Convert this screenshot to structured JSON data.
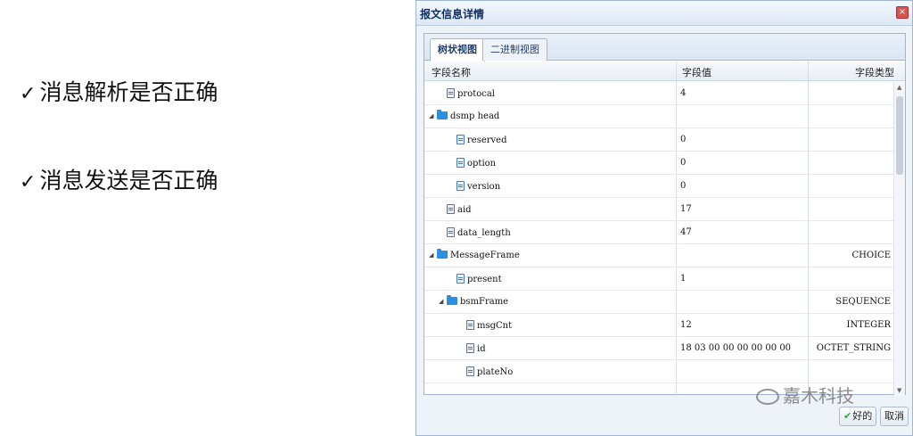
{
  "slide": {
    "bullets": [
      {
        "check": "✓",
        "text": "消息解析是否正确"
      },
      {
        "check": "✓",
        "text": "消息发送是否正确"
      }
    ]
  },
  "dialog": {
    "title": "报文信息详情",
    "close_label": "×",
    "tabs": [
      {
        "label": "树状视图",
        "active": true
      },
      {
        "label": "二进制视图",
        "active": false
      }
    ],
    "columns": [
      "字段名称",
      "字段值",
      "字段类型"
    ],
    "rows": [
      {
        "name": "protocal",
        "value": "4",
        "type": "",
        "icon": "leaf-icon",
        "level": 1,
        "toggle": ""
      },
      {
        "name": "dsmp head",
        "value": "",
        "type": "",
        "icon": "folder-icon",
        "level": 0,
        "toggle": "◢"
      },
      {
        "name": "reserved",
        "value": "0",
        "type": "",
        "icon": "leaf-icon",
        "level": 2,
        "toggle": ""
      },
      {
        "name": "option",
        "value": "0",
        "type": "",
        "icon": "leaf-icon",
        "level": 2,
        "toggle": ""
      },
      {
        "name": "version",
        "value": "0",
        "type": "",
        "icon": "leaf-icon",
        "level": 2,
        "toggle": ""
      },
      {
        "name": "aid",
        "value": "17",
        "type": "",
        "icon": "leaf-icon",
        "level": 1,
        "toggle": ""
      },
      {
        "name": "data_length",
        "value": "47",
        "type": "",
        "icon": "leaf-icon",
        "level": 1,
        "toggle": ""
      },
      {
        "name": "MessageFrame",
        "value": "",
        "type": "CHOICE",
        "icon": "folder-icon",
        "level": 0,
        "toggle": "◢"
      },
      {
        "name": "present",
        "value": "1",
        "type": "",
        "icon": "leaf-icon",
        "level": 2,
        "toggle": ""
      },
      {
        "name": "bsmFrame",
        "value": "",
        "type": "SEQUENCE",
        "icon": "folder-icon",
        "level": 1,
        "toggle": "◢"
      },
      {
        "name": "msgCnt",
        "value": "12",
        "type": "INTEGER",
        "icon": "leaf-icon",
        "level": 3,
        "toggle": ""
      },
      {
        "name": "id",
        "value": "18 03 00 00 00 00 00 00",
        "type": "OCTET_STRING",
        "icon": "leaf-icon",
        "level": 3,
        "toggle": ""
      },
      {
        "name": "plateNo",
        "value": "",
        "type": "",
        "icon": "leaf-icon",
        "level": 3,
        "toggle": ""
      }
    ],
    "buttons": {
      "ok_check": "✔",
      "ok": "好的",
      "cancel": "取消"
    }
  },
  "watermark": {
    "text": "嘉木科技"
  }
}
